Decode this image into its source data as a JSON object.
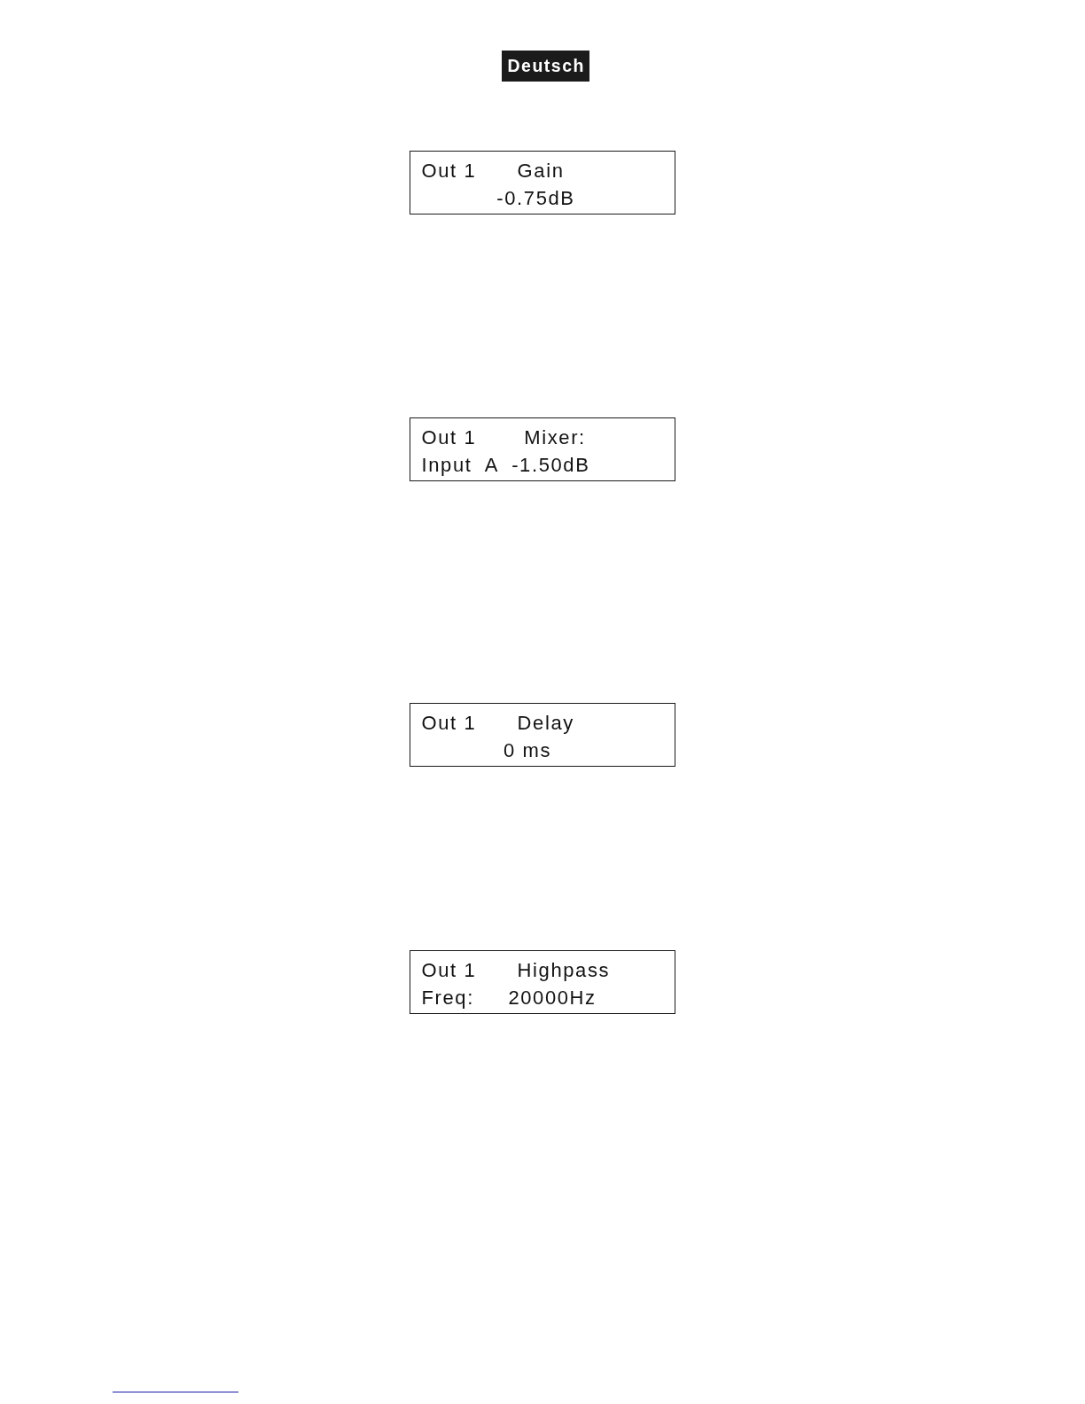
{
  "language_tab": {
    "label": "Deutsch"
  },
  "displays": [
    {
      "lines": [
        "Out 1      Gain",
        "           -0.75dB"
      ]
    },
    {
      "lines": [
        "Out 1       Mixer:",
        "Input  A  -1.50dB"
      ]
    },
    {
      "lines": [
        "Out 1      Delay",
        "            0 ms"
      ]
    },
    {
      "lines": [
        "Out 1      Highpass",
        "Freq:     20000Hz"
      ]
    }
  ]
}
